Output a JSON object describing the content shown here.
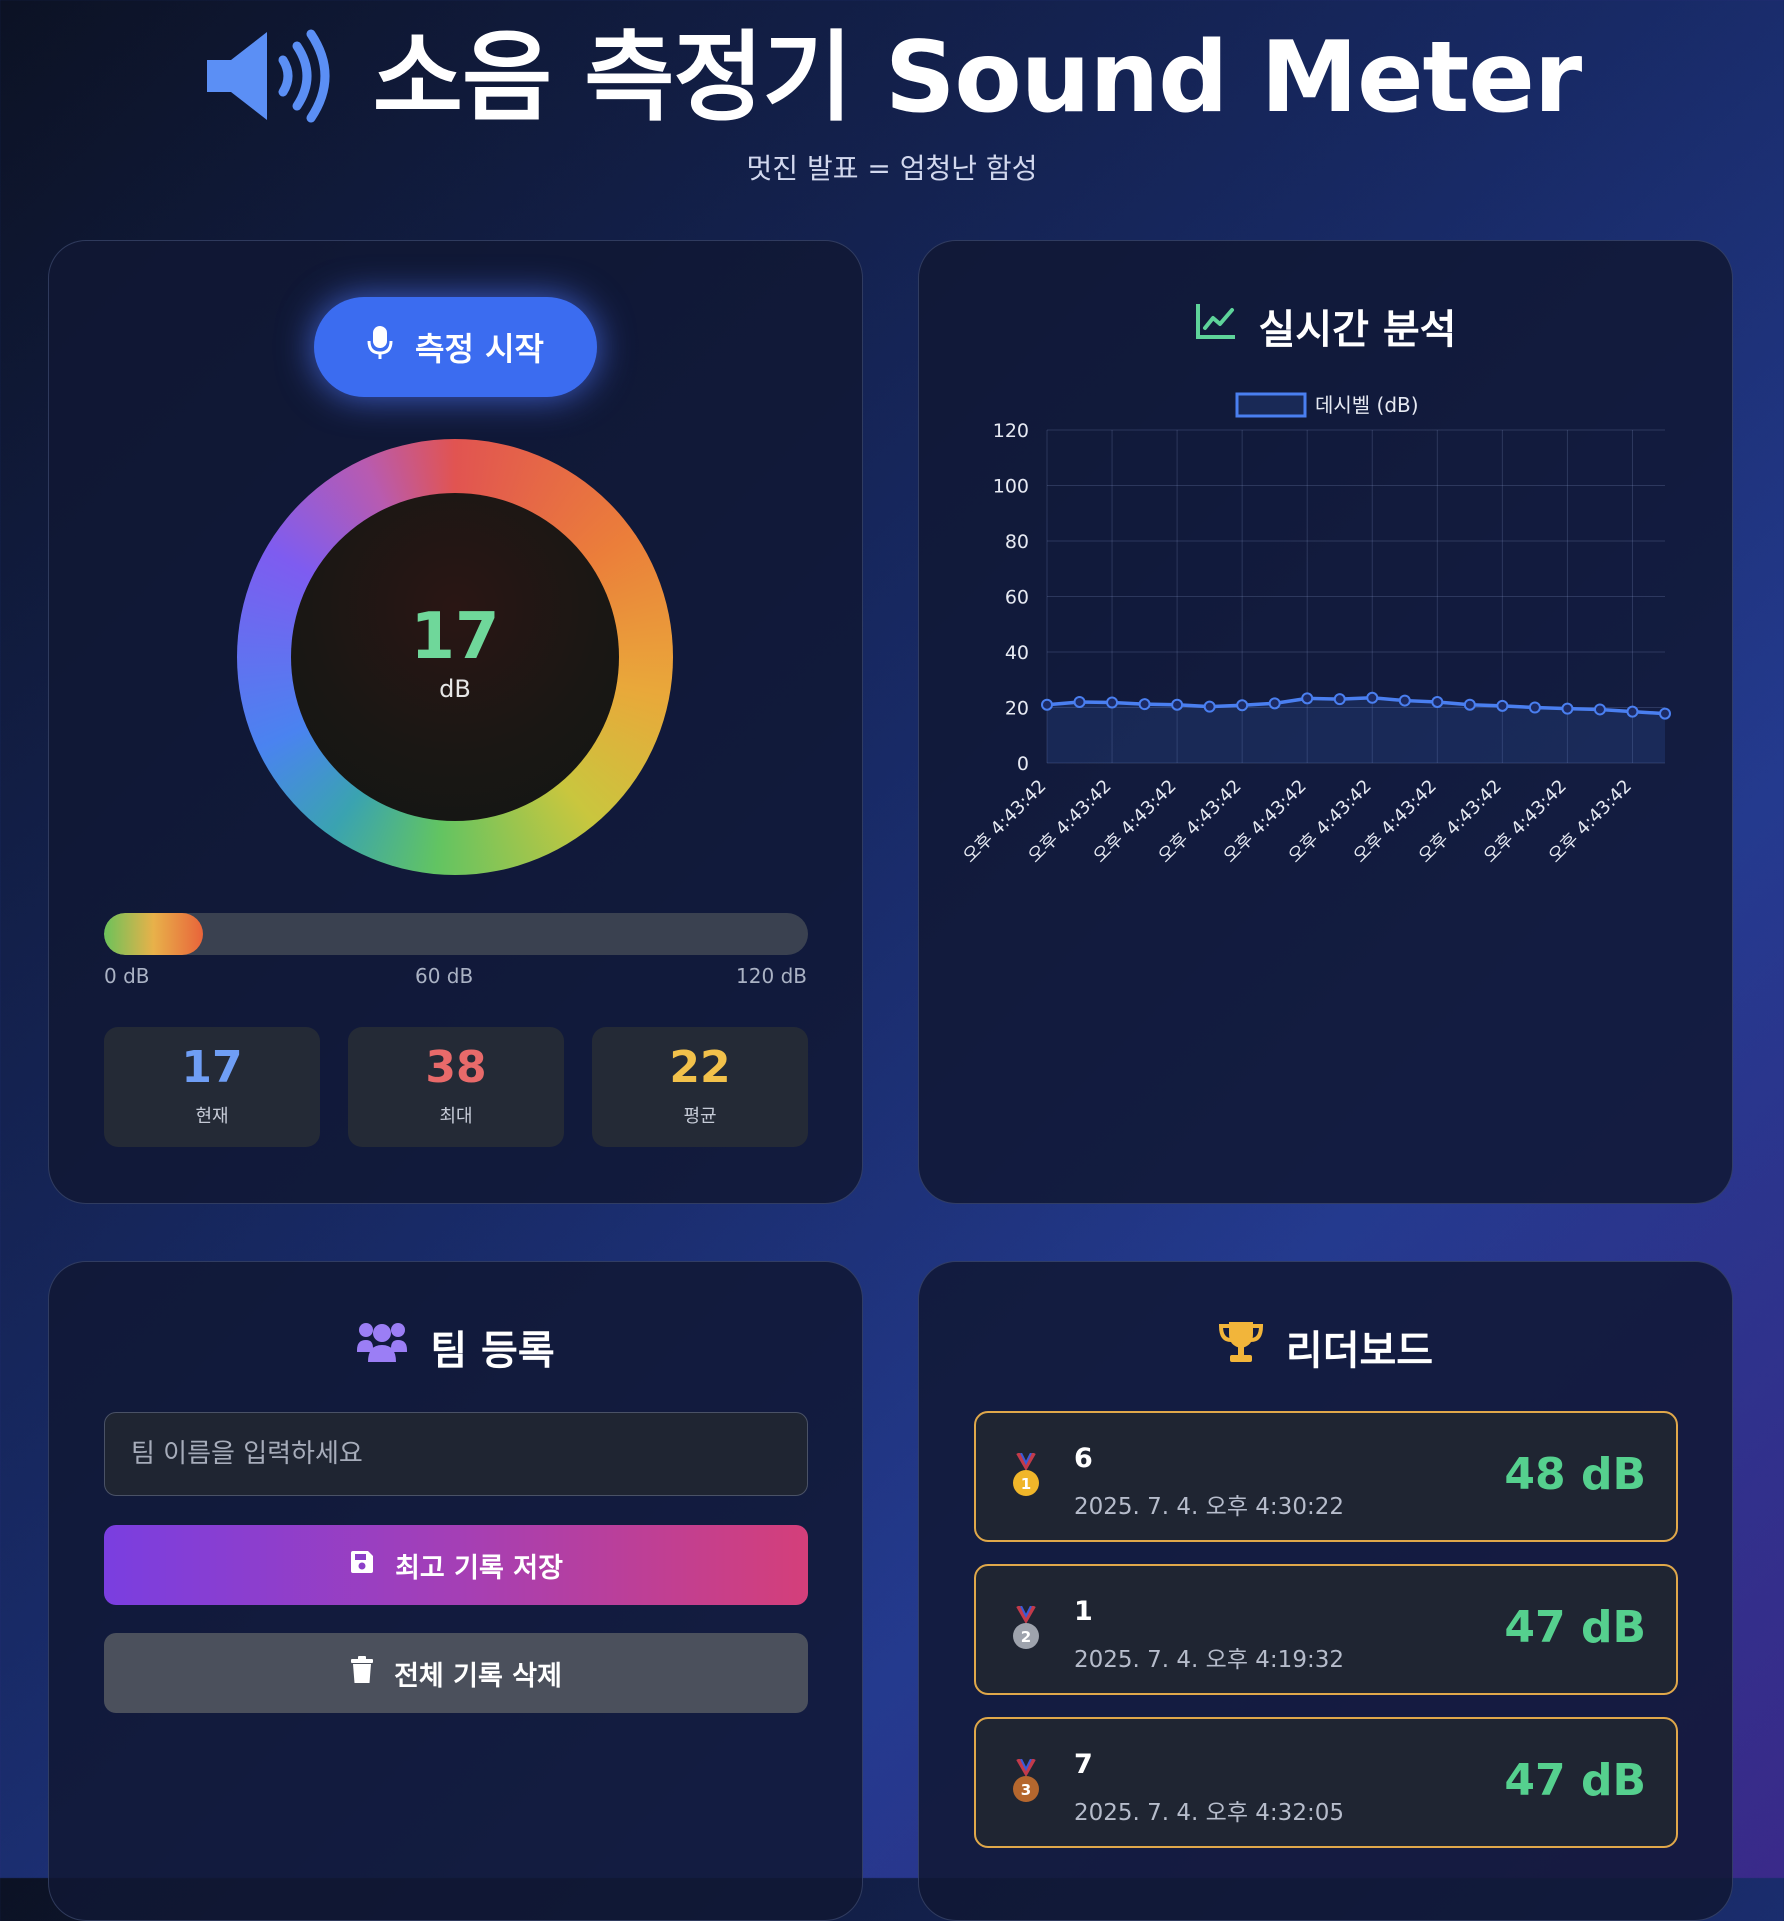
{
  "header": {
    "title": "소음 측정기 Sound Meter",
    "subtitle": "멋진 발표 = 엄청난 함성",
    "speaker_icon": "volume-high-icon"
  },
  "meter": {
    "start_label": "측정 시작",
    "icon": "microphone-icon",
    "current_value": "17",
    "unit": "dB",
    "level_fraction": 0.14,
    "scale": [
      "0 dB",
      "60 dB",
      "120 dB"
    ],
    "stats": [
      {
        "value": "17",
        "label": "현재",
        "color": "#6f9ef5"
      },
      {
        "value": "38",
        "label": "최대",
        "color": "#e86a6a"
      },
      {
        "value": "22",
        "label": "평균",
        "color": "#f2c14b"
      }
    ]
  },
  "analysis": {
    "title": "실시간 분석",
    "icon": "chart-line-icon"
  },
  "chart_data": {
    "type": "line",
    "title": "",
    "series": [
      {
        "name": "데시벨 (dB)",
        "values": [
          21,
          22,
          21.8,
          21.2,
          21,
          20.3,
          20.8,
          21.5,
          23.3,
          23,
          23.5,
          22.5,
          22,
          21,
          20.6,
          20,
          19.6,
          19.3,
          18.5,
          17.8
        ]
      }
    ],
    "x": [
      "오후 4:43:42",
      "오후 4:43:42",
      "오후 4:43:42",
      "오후 4:43:42",
      "오후 4:43:42",
      "오후 4:43:42",
      "오후 4:43:42",
      "오후 4:43:42",
      "오후 4:43:42",
      "오후 4:43:42",
      "오후 4:43:42",
      "오후 4:43:42",
      "오후 4:43:42",
      "오후 4:43:42",
      "오후 4:43:42",
      "오후 4:43:42",
      "오후 4:43:42",
      "오후 4:43:42",
      "오후 4:43:42",
      "오후 4:43:42"
    ],
    "x_tick_labels": [
      "오후 4:43:42",
      "오후 4:43:42",
      "오후 4:43:42",
      "오후 4:43:42",
      "오후 4:43:42",
      "오후 4:43:42",
      "오후 4:43:42",
      "오후 4:43:42",
      "오후 4:43:42",
      "오후 4:43:42"
    ],
    "y_ticks": [
      "0",
      "20",
      "40",
      "60",
      "80",
      "100",
      "120"
    ],
    "ylim": [
      0,
      120
    ],
    "grid": true,
    "legend": "top",
    "line_color": "#4a7ff0"
  },
  "team": {
    "title": "팀 등록",
    "icon": "users-icon",
    "input_placeholder": "팀 이름을 입력하세요",
    "input_value": "",
    "save_label": "최고 기록 저장",
    "save_icon": "floppy-disk-icon",
    "delete_label": "전체 기록 삭제",
    "delete_icon": "trash-icon"
  },
  "leaderboard": {
    "title": "리더보드",
    "icon": "trophy-icon",
    "entries": [
      {
        "rank": "1",
        "name": "6",
        "date": "2025. 7. 4. 오후 4:30:22",
        "score": "48 dB",
        "medal_color": "#f0b62a"
      },
      {
        "rank": "2",
        "name": "1",
        "date": "2025. 7. 4. 오후 4:19:32",
        "score": "47 dB",
        "medal_color": "#9ea3ad"
      },
      {
        "rank": "3",
        "name": "7",
        "date": "2025. 7. 4. 오후 4:32:05",
        "score": "47 dB",
        "medal_color": "#b5672e"
      }
    ]
  }
}
